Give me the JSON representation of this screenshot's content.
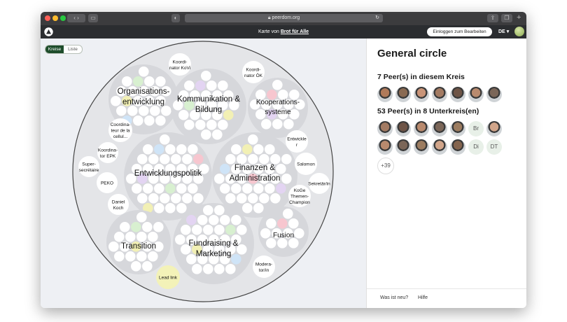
{
  "browser": {
    "url": "peerdom.org"
  },
  "app": {
    "title_prefix": "Karte von",
    "title_org": "Brot für Alle",
    "login_button": "Einloggen zum Bearbeiten",
    "language": "DE"
  },
  "view_toggle": {
    "active": "Kreise",
    "inactive": "Liste"
  },
  "map": {
    "circles": [
      {
        "name": "org",
        "label": [
          "Organisations-",
          "entwicklung"
        ]
      },
      {
        "name": "komm",
        "label": [
          "Kommunikation &",
          "Bildung"
        ]
      },
      {
        "name": "koop",
        "label": [
          "Kooperations-",
          "systeme"
        ]
      },
      {
        "name": "entw",
        "label": [
          "Entwicklungspolitik"
        ]
      },
      {
        "name": "fin",
        "label": [
          "Finanzen &",
          "Administration"
        ]
      },
      {
        "name": "trans",
        "label": [
          "Transition"
        ]
      },
      {
        "name": "fund",
        "label": [
          "Fundraising &",
          "Marketing"
        ]
      },
      {
        "name": "fusion",
        "label": [
          "Fusion"
        ]
      }
    ],
    "roles": [
      {
        "label": [
          "Koordi-",
          "nator KoVi"
        ]
      },
      {
        "label": [
          "Koordi-",
          "nator ÖK"
        ]
      },
      {
        "label": [
          "Coordina-",
          "teur de la",
          "cellul..."
        ]
      },
      {
        "label": [
          "Koordina-",
          "tor EPK"
        ]
      },
      {
        "label": [
          "Super-",
          "secrétaire"
        ]
      },
      {
        "label": [
          "PEKO"
        ]
      },
      {
        "label": [
          "Daniel",
          "Koch"
        ]
      },
      {
        "label": [
          "Entwickle",
          "r"
        ]
      },
      {
        "label": [
          "Salomon"
        ]
      },
      {
        "label": [
          "Sekretär/in"
        ]
      },
      {
        "label": [
          "KoGe",
          "Themen-",
          "Champion"
        ]
      },
      {
        "label": [
          "Moderа-",
          "tor/in"
        ]
      },
      {
        "label": [
          "Lead link"
        ]
      }
    ]
  },
  "panel": {
    "title": "General circle",
    "peers_heading": "7 Peer(s) in diesem Kreis",
    "sub_heading": "53 Peer(s) in 8 Unterkreis(en)",
    "initials": [
      "Br",
      "Di",
      "DT"
    ],
    "more": "+39",
    "footer_news": "Was ist neu?",
    "footer_help": "Hilfe"
  },
  "colors": {
    "app_bar": "#2b2d30",
    "accent": "#1e4d2b"
  }
}
